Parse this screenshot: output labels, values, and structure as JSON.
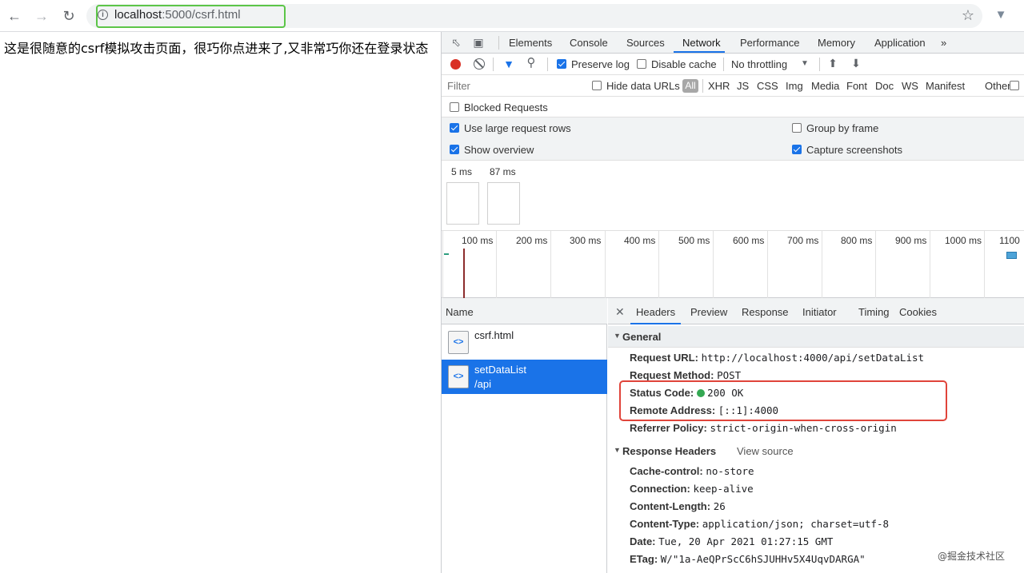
{
  "browser": {
    "url_host": "localhost",
    "url_rest": ":5000/csrf.html",
    "colors": {
      "url_highlight": "#5cc548"
    }
  },
  "page": {
    "text": "这是很随意的csrf模拟攻击页面，很巧你点进来了,又非常巧你还在登录状态"
  },
  "devtools": {
    "tabs": [
      "Elements",
      "Console",
      "Sources",
      "Network",
      "Performance",
      "Memory",
      "Application",
      "»"
    ],
    "active_tab": "Network",
    "toolbar": {
      "preserve_log": "Preserve log",
      "disable_cache": "Disable cache",
      "throttling": "No throttling"
    },
    "filter": {
      "placeholder": "Filter",
      "hide_data_urls": "Hide data URLs",
      "all": "All",
      "types": [
        "XHR",
        "JS",
        "CSS",
        "Img",
        "Media",
        "Font",
        "Doc",
        "WS",
        "Manifest",
        "Other"
      ]
    },
    "blocked_requests": "Blocked Requests",
    "settings": {
      "use_large_rows": "Use large request rows",
      "group_by_frame": "Group by frame",
      "show_overview": "Show overview",
      "capture_screenshots": "Capture screenshots"
    },
    "screenshots": {
      "times": [
        "5 ms",
        "87 ms"
      ]
    },
    "timeline": {
      "ticks": [
        "100 ms",
        "200 ms",
        "300 ms",
        "400 ms",
        "500 ms",
        "600 ms",
        "700 ms",
        "800 ms",
        "900 ms",
        "1000 ms",
        "1100"
      ]
    },
    "request_list": {
      "header": "Name",
      "rows": [
        {
          "name": "csrf.html",
          "sub": ""
        },
        {
          "name": "setDataList",
          "sub": "/api"
        }
      ]
    },
    "details": {
      "tabs": [
        "Headers",
        "Preview",
        "Response",
        "Initiator",
        "Timing",
        "Cookies"
      ],
      "active_tab": "Headers",
      "general_title": "General",
      "general": [
        {
          "k": "Request URL:",
          "v": "http://localhost:4000/api/setDataList"
        },
        {
          "k": "Request Method:",
          "v": "POST"
        },
        {
          "k": "Status Code:",
          "v": "200 OK"
        },
        {
          "k": "Remote Address:",
          "v": "[::1]:4000"
        },
        {
          "k": "Referrer Policy:",
          "v": "strict-origin-when-cross-origin"
        }
      ],
      "response_title": "Response Headers",
      "view_source": "View source",
      "response": [
        {
          "k": "Cache-control:",
          "v": "no-store"
        },
        {
          "k": "Connection:",
          "v": "keep-alive"
        },
        {
          "k": "Content-Length:",
          "v": "26"
        },
        {
          "k": "Content-Type:",
          "v": "application/json; charset=utf-8"
        },
        {
          "k": "Date:",
          "v": "Tue, 20 Apr 2021 01:27:15 GMT"
        },
        {
          "k": "ETag:",
          "v": "W/\"1a-AeQPrScC6hSJUHHv5X4UqvDARGA\""
        }
      ],
      "colors": {
        "highlight_box": "#e0443a"
      }
    }
  },
  "watermark": "@掘金技术社区"
}
